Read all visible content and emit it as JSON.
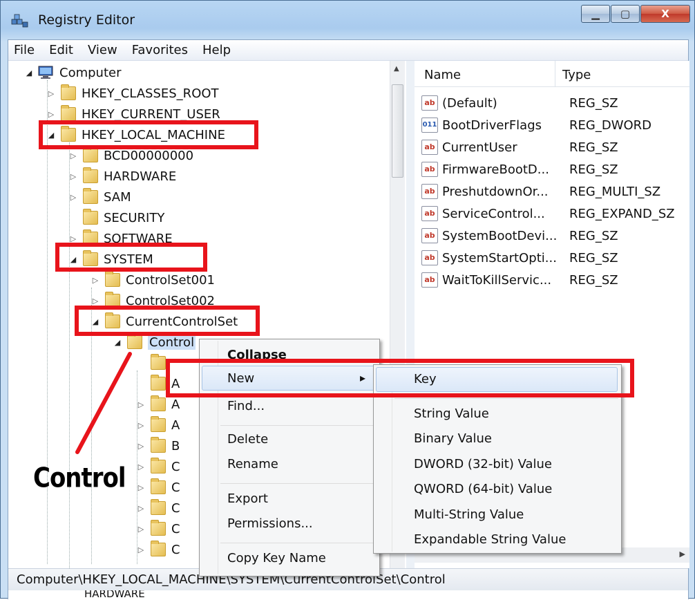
{
  "window": {
    "title": "Registry Editor",
    "controls": {
      "minimize": "▁",
      "maximize": "▢",
      "close": "X"
    }
  },
  "menu": [
    "File",
    "Edit",
    "View",
    "Favorites",
    "Help"
  ],
  "tree": {
    "root": "Computer",
    "items": [
      {
        "label": "HKEY_CLASSES_ROOT",
        "state": "collapsed"
      },
      {
        "label": "HKEY_CURRENT_USER",
        "state": "collapsed"
      },
      {
        "label": "HKEY_LOCAL_MACHINE",
        "state": "expanded"
      },
      {
        "label": "BCD00000000",
        "state": "collapsed"
      },
      {
        "label": "HARDWARE",
        "state": "collapsed"
      },
      {
        "label": "SAM",
        "state": "collapsed"
      },
      {
        "label": "SECURITY",
        "state": "leaf"
      },
      {
        "label": "SOFTWARE",
        "state": "collapsed"
      },
      {
        "label": "SYSTEM",
        "state": "expanded"
      },
      {
        "label": "ControlSet001",
        "state": "collapsed"
      },
      {
        "label": "ControlSet002",
        "state": "collapsed"
      },
      {
        "label": "CurrentControlSet",
        "state": "expanded"
      },
      {
        "label": "Control",
        "state": "expanded"
      },
      {
        "label": "HARDWARE",
        "state": "collapsed"
      }
    ],
    "partial_children": [
      "",
      "A",
      "A",
      "A",
      "B",
      "C",
      "C",
      "C",
      "C",
      "C"
    ]
  },
  "list": {
    "columns": {
      "name": "Name",
      "type": "Type"
    },
    "rows": [
      {
        "name": "(Default)",
        "type": "REG_SZ",
        "icon": "ab"
      },
      {
        "name": "BootDriverFlags",
        "type": "REG_DWORD",
        "icon": "bin"
      },
      {
        "name": "CurrentUser",
        "type": "REG_SZ",
        "icon": "ab"
      },
      {
        "name": "FirmwareBootD...",
        "type": "REG_SZ",
        "icon": "ab"
      },
      {
        "name": "PreshutdownOr...",
        "type": "REG_MULTI_SZ",
        "icon": "ab"
      },
      {
        "name": "ServiceControl...",
        "type": "REG_EXPAND_SZ",
        "icon": "ab"
      },
      {
        "name": "SystemBootDevi...",
        "type": "REG_SZ",
        "icon": "ab"
      },
      {
        "name": "SystemStartOpti...",
        "type": "REG_SZ",
        "icon": "ab"
      },
      {
        "name": "WaitToKillServic...",
        "type": "REG_SZ",
        "icon": "ab"
      }
    ]
  },
  "context_menu": {
    "items": [
      "Collapse",
      "New",
      "Find...",
      "Delete",
      "Rename",
      "Export",
      "Permissions...",
      "Copy Key Name"
    ],
    "submenu_arrow": "▸"
  },
  "submenu": {
    "items": [
      "Key",
      "String Value",
      "Binary Value",
      "DWORD (32-bit) Value",
      "QWORD (64-bit) Value",
      "Multi-String Value",
      "Expandable String Value"
    ]
  },
  "statusbar": {
    "path": "Computer\\HKEY_LOCAL_MACHINE\\SYSTEM\\CurrentControlSet\\Control"
  },
  "annotation": {
    "label": "Control",
    "color": "#e8141b"
  }
}
